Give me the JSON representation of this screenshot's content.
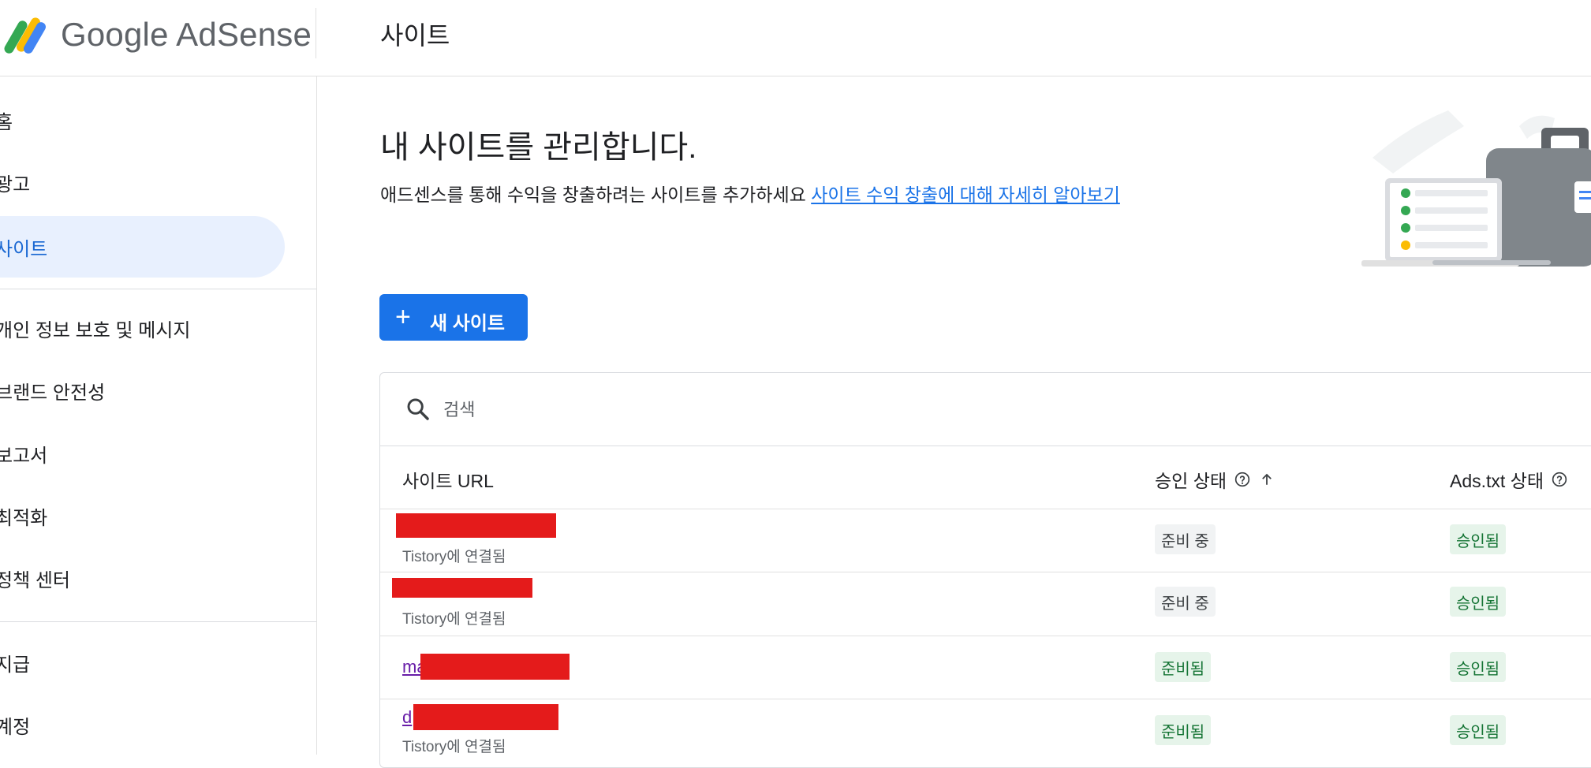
{
  "header": {
    "logo_text": "Google AdSense",
    "page_title": "사이트"
  },
  "sidebar": {
    "items": [
      {
        "label": "홈"
      },
      {
        "label": "광고"
      },
      {
        "label": "사이트"
      },
      {
        "label": "개인 정보 보호 및 메시지"
      },
      {
        "label": "브랜드 안전성"
      },
      {
        "label": "보고서"
      },
      {
        "label": "최적화"
      },
      {
        "label": "정책 센터"
      },
      {
        "label": "지급"
      },
      {
        "label": "계정"
      }
    ],
    "active": "사이트"
  },
  "main": {
    "title": "내 사이트를 관리합니다.",
    "description": "애드센스를 통해 수익을 창출하려는 사이트를 추가하세요",
    "learn_more_link": "사이트 수익 창출에 대해 자세히 알아보기",
    "new_site_button": "새 사이트",
    "search_placeholder": "검색"
  },
  "table": {
    "columns": {
      "url": "사이트 URL",
      "approval": "승인 상태",
      "adstxt": "Ads.txt 상태"
    },
    "rows": [
      {
        "url_visible": "",
        "subtitle": "Tistory에 연결됨",
        "approval": "준비 중",
        "adstxt": "승인됨"
      },
      {
        "url_visible": "",
        "subtitle": "Tistory에 연결됨",
        "approval": "준비 중",
        "adstxt": "승인됨"
      },
      {
        "url_visible": "ma",
        "subtitle": "",
        "approval": "준비됨",
        "adstxt": "승인됨"
      },
      {
        "url_visible": "d",
        "subtitle": "Tistory에 연결됨",
        "approval": "준비됨",
        "adstxt": "승인됨"
      }
    ]
  },
  "colors": {
    "primary": "#1a73e8",
    "active_nav_bg": "#e8f0fe",
    "active_nav_text": "#1967d2",
    "status_green_bg": "#e6f4ea",
    "status_green_text": "#137333",
    "status_gray_bg": "#f1f3f4",
    "redaction": "#e41b1b",
    "visited_link": "#681da8"
  },
  "icons": {
    "logo": "adsense-logo-icon",
    "search": "search-icon",
    "help": "help-circle-icon",
    "sort": "arrow-up-icon",
    "plus": "plus-icon"
  }
}
